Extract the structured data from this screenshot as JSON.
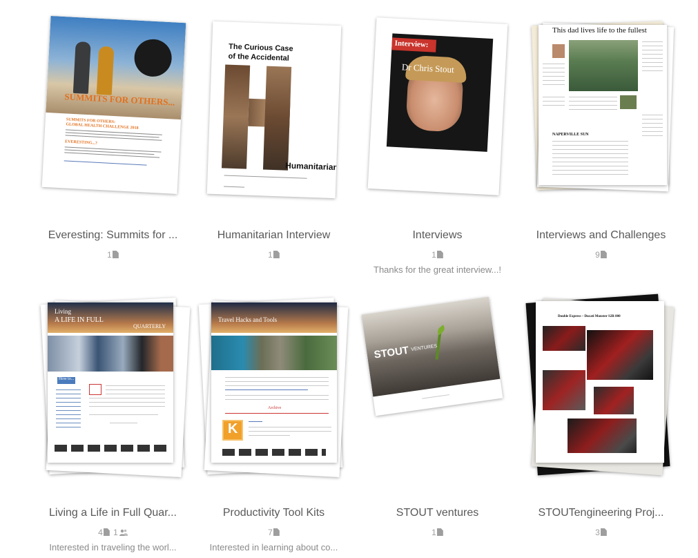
{
  "collections": [
    {
      "title": "Everesting: Summits for ...",
      "doc_count": "1",
      "description": "",
      "thumb_text": [
        "SUMMITS FOR OTHERS...",
        "SUMMITS FOR OTHERS:",
        "GLOBAL HEALTH CHALLENGE 2018",
        "EVERESTING...?"
      ]
    },
    {
      "title": "Humanitarian Interview",
      "doc_count": "1",
      "description": "",
      "thumb_text": [
        "The Curious Case",
        "of the Accidental",
        "Humanitarian"
      ]
    },
    {
      "title": "Interviews",
      "doc_count": "1",
      "description": "Thanks for the great interview...!",
      "thumb_text": [
        "Interview:",
        "Dr Chris Stout"
      ]
    },
    {
      "title": "Interviews and Challenges",
      "doc_count": "9",
      "description": "",
      "thumb_text": [
        "This dad lives life to the fullest",
        "NAPERVILLE SUN"
      ]
    },
    {
      "title": "Living a Life in Full Quar...",
      "doc_count": "4",
      "follower_count": "1",
      "description": "Interested in traveling the worl...",
      "thumb_text": [
        "Living",
        "A LIFE IN FULL",
        "QUARTERLY",
        "How to..."
      ]
    },
    {
      "title": "Productivity Tool Kits",
      "doc_count": "7",
      "description": "Interested in learning about co...",
      "thumb_text": [
        "Travel Hacks and Tools",
        "Archive",
        "K"
      ]
    },
    {
      "title": "STOUT ventures",
      "doc_count": "1",
      "description": "",
      "thumb_text": [
        "STOUT",
        "VENTURES"
      ]
    },
    {
      "title": "STOUTengineering Proj...",
      "doc_count": "3",
      "description": "",
      "thumb_text": [
        "Double Express – Ducati Monster S2R 800"
      ]
    }
  ],
  "colors": {
    "title_text": "#595959",
    "meta_text": "#9e9e9e",
    "description_text": "#8a8a8a"
  },
  "icons": {
    "document": "document-icon",
    "followers": "people-icon"
  }
}
